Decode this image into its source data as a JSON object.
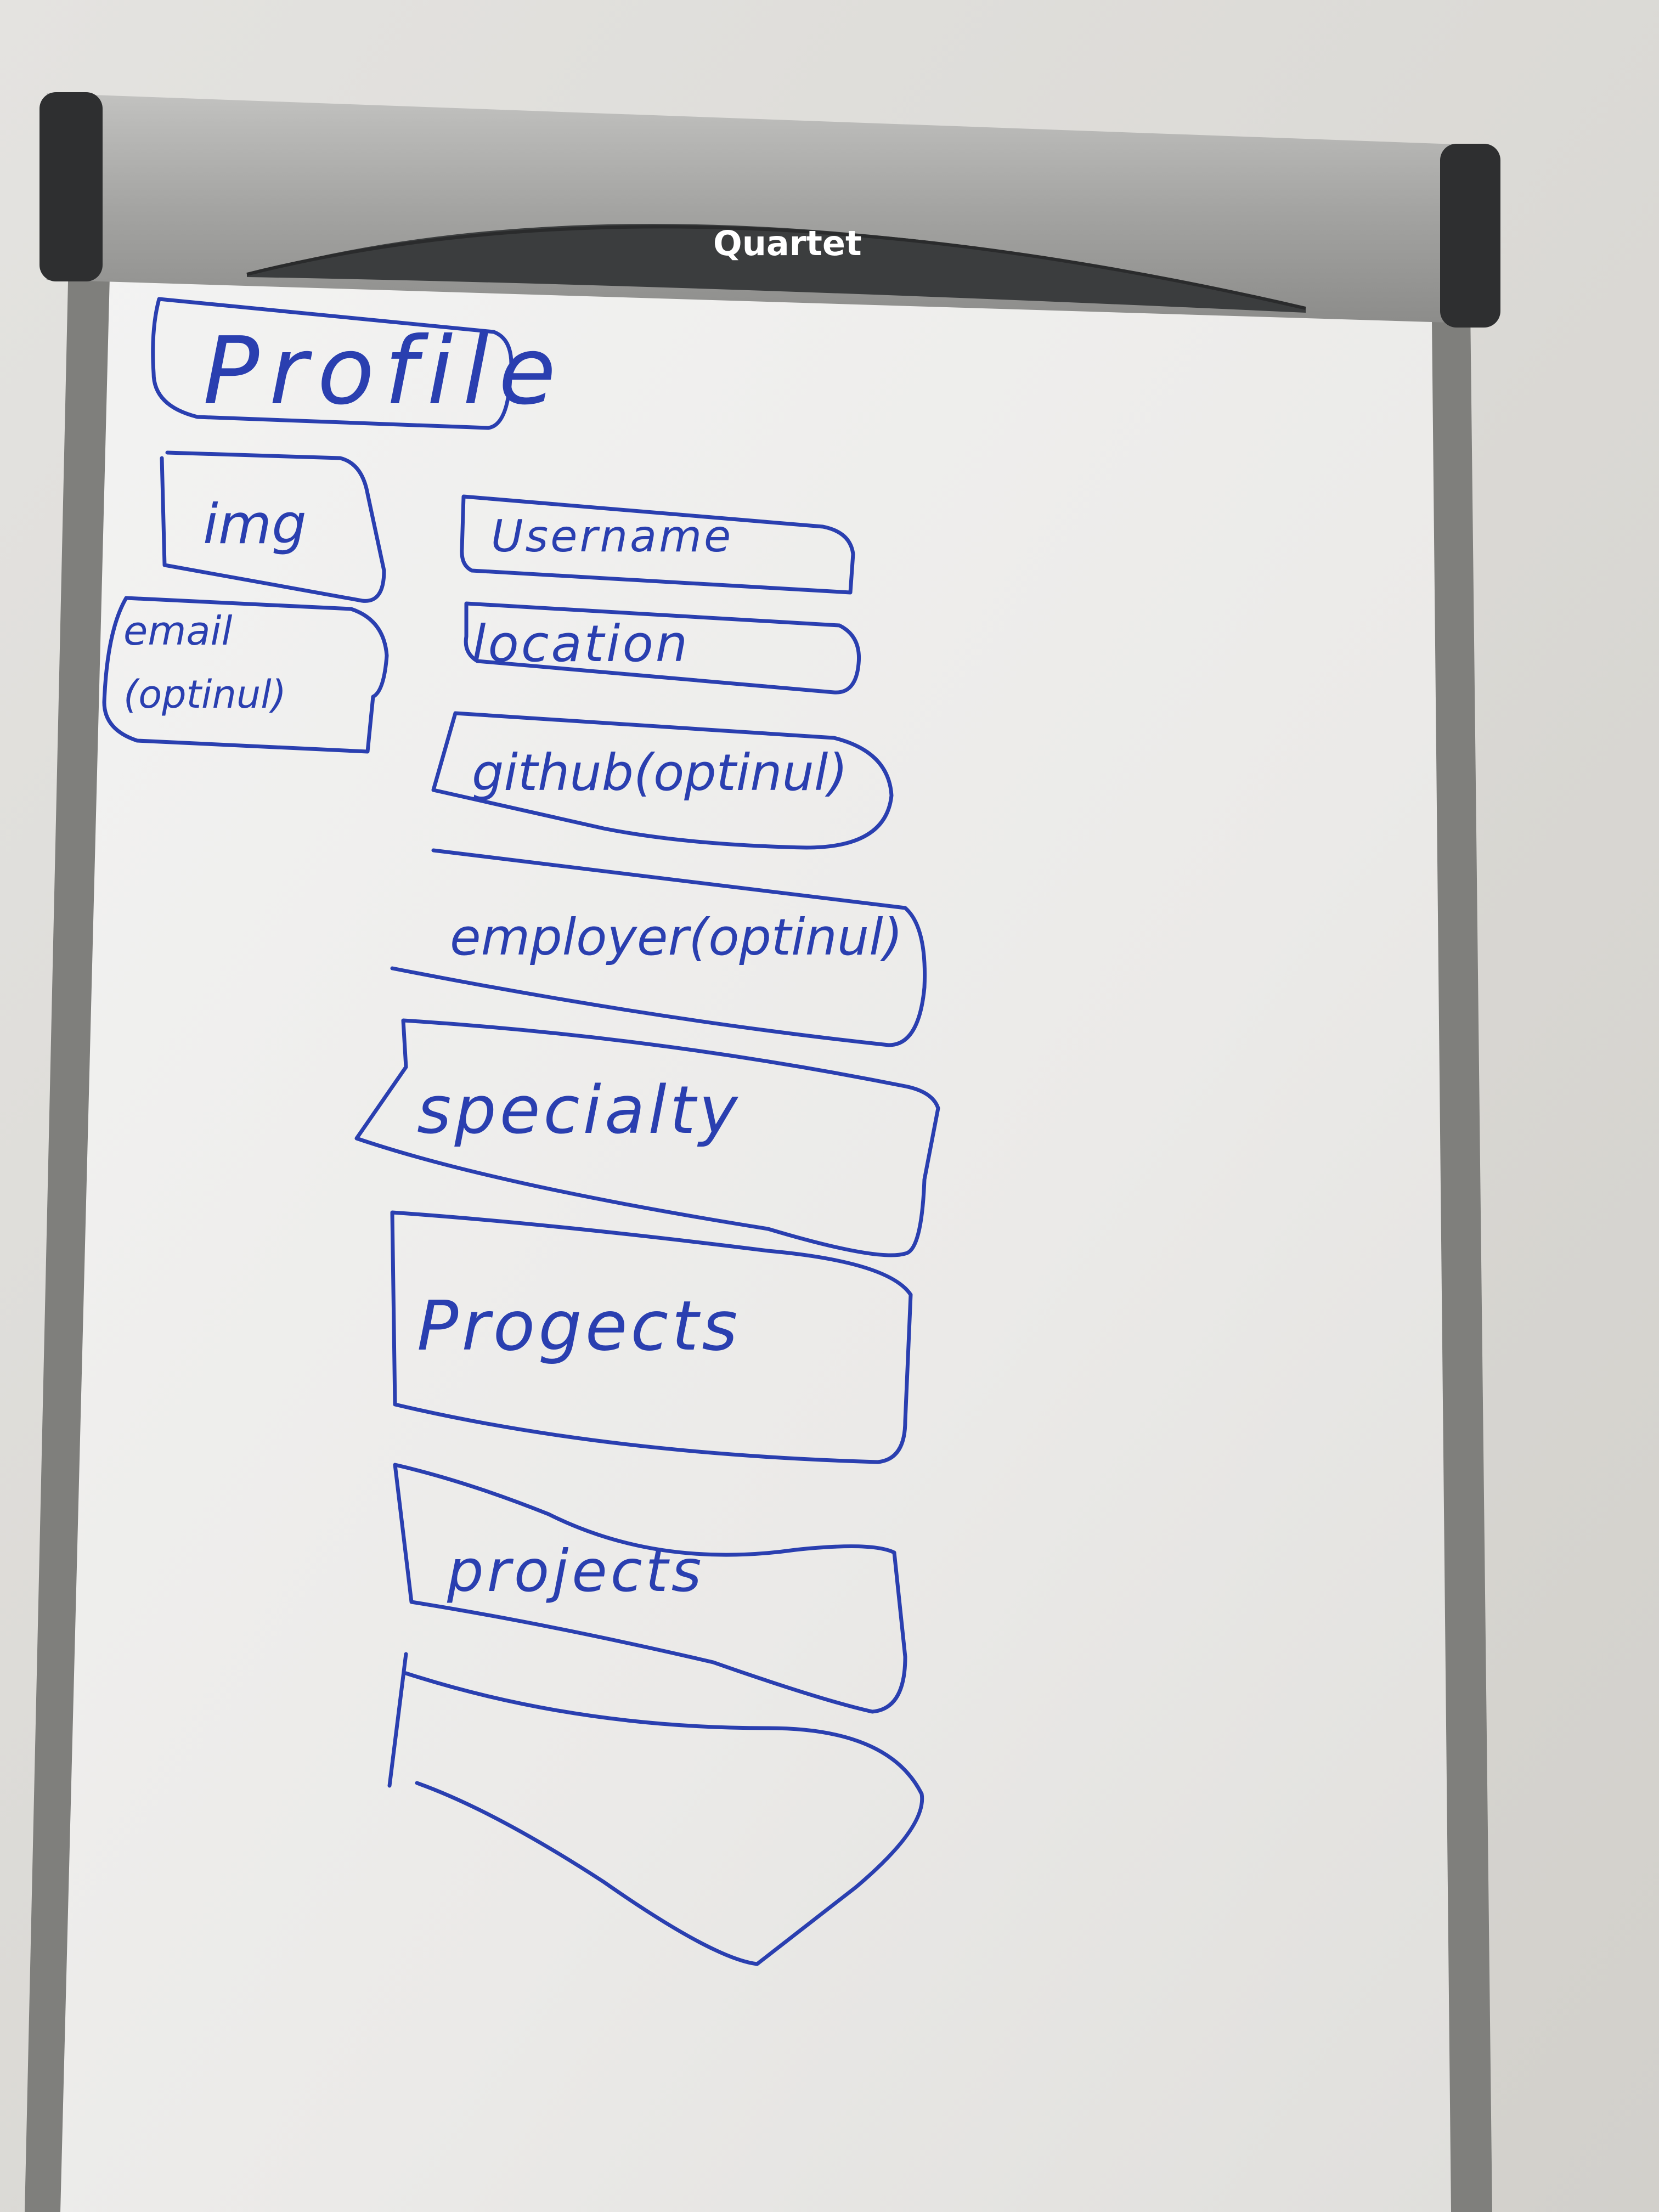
{
  "header": {
    "brand": "Quartet"
  },
  "wireframe": {
    "title": "Profile",
    "image_box": "img",
    "email_box": {
      "line1": "email",
      "line2": "(optinul)"
    },
    "fields": [
      "Username",
      "location",
      "github(optinul)",
      "employer(optinul)",
      "specialty",
      "Progects",
      "projects"
    ]
  },
  "colors": {
    "wall": "#dcdad6",
    "board": "#ecebea",
    "frame": "#8a8a88",
    "marker": "#2a3fb0",
    "header_bar": "#a9a9a7",
    "header_dark": "#3b3d3e"
  }
}
